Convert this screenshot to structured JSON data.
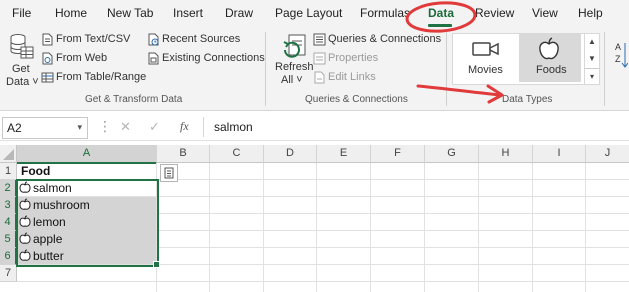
{
  "menu": {
    "items": [
      "File",
      "Home",
      "New Tab",
      "Insert",
      "Draw",
      "Page Layout",
      "Formulas",
      "Data",
      "Review",
      "View",
      "Help"
    ],
    "active": "Data"
  },
  "ribbon": {
    "get_data": {
      "line1": "Get",
      "line2": "Data ˅"
    },
    "from_text_csv": "From Text/CSV",
    "from_web": "From Web",
    "from_table_range": "From Table/Range",
    "recent_sources": "Recent Sources",
    "existing_connections": "Existing Connections",
    "group_get_transform": "Get & Transform Data",
    "refresh_all": {
      "line1": "Refresh",
      "line2": "All ˅"
    },
    "queries_connections": "Queries & Connections",
    "properties": "Properties",
    "edit_links": "Edit Links",
    "group_queries": "Queries & Connections",
    "data_types": {
      "movies": "Movies",
      "foods": "Foods",
      "group": "Data Types",
      "selected": "Foods"
    }
  },
  "formula_bar": {
    "name_box": "A2",
    "cancel_glyph": "✕",
    "enter_glyph": "✓",
    "fx_label": "fx",
    "value": "salmon"
  },
  "sheet": {
    "columns": [
      "A",
      "B",
      "C",
      "D",
      "E",
      "F",
      "G",
      "H",
      "I",
      "J"
    ],
    "rows": [
      "1",
      "2",
      "3",
      "4",
      "5",
      "6",
      "7"
    ],
    "header_cell": "Food",
    "food_items": [
      "salmon",
      "mushroom",
      "lemon",
      "apple",
      "butter"
    ],
    "active_cell": "A2"
  },
  "colors": {
    "accent": "#217346",
    "annotation": "#e03a3a",
    "selection_fill": "#d4d4d4"
  }
}
